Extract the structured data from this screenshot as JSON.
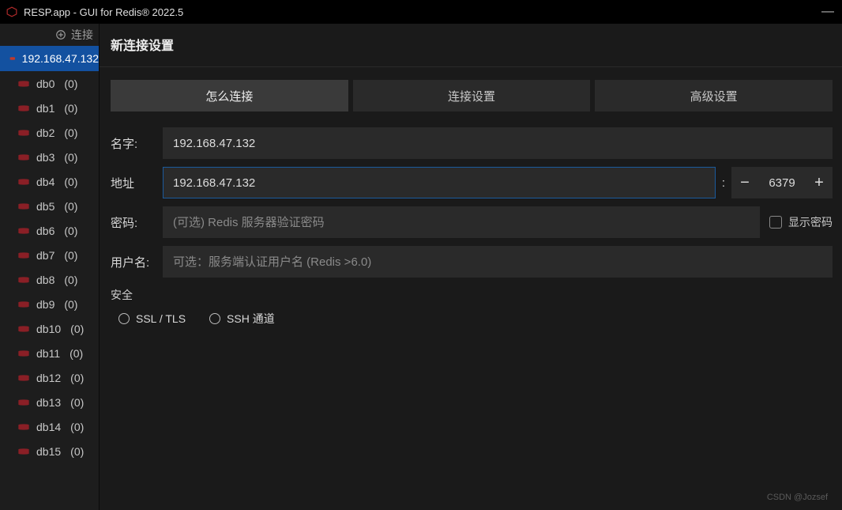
{
  "titlebar": {
    "title": "RESP.app - GUI for Redis® 2022.5"
  },
  "sidebar": {
    "add_label": "连接",
    "connection": "192.168.47.132",
    "dbs": [
      {
        "name": "db0",
        "count": "(0)"
      },
      {
        "name": "db1",
        "count": "(0)"
      },
      {
        "name": "db2",
        "count": "(0)"
      },
      {
        "name": "db3",
        "count": "(0)"
      },
      {
        "name": "db4",
        "count": "(0)"
      },
      {
        "name": "db5",
        "count": "(0)"
      },
      {
        "name": "db6",
        "count": "(0)"
      },
      {
        "name": "db7",
        "count": "(0)"
      },
      {
        "name": "db8",
        "count": "(0)"
      },
      {
        "name": "db9",
        "count": "(0)"
      },
      {
        "name": "db10",
        "count": "(0)"
      },
      {
        "name": "db11",
        "count": "(0)"
      },
      {
        "name": "db12",
        "count": "(0)"
      },
      {
        "name": "db13",
        "count": "(0)"
      },
      {
        "name": "db14",
        "count": "(0)"
      },
      {
        "name": "db15",
        "count": "(0)"
      }
    ]
  },
  "dialog": {
    "title": "新连接设置",
    "tabs": {
      "how": "怎么连接",
      "conn": "连接设置",
      "adv": "高级设置"
    },
    "labels": {
      "name": "名字:",
      "addr": "地址",
      "pwd": "密码:",
      "user": "用户名:",
      "security": "安全"
    },
    "name_value": "192.168.47.132",
    "addr_value": "192.168.47.132",
    "port_value": "6379",
    "colon": ":",
    "pwd_placeholder": "(可选) Redis 服务器验证密码",
    "user_placeholder": "可选：服务端认证用户名 (Redis >6.0)",
    "show_pwd": "显示密码",
    "ssl": "SSL / TLS",
    "ssh": "SSH 通道"
  },
  "watermark": "CSDN @Jozsef"
}
